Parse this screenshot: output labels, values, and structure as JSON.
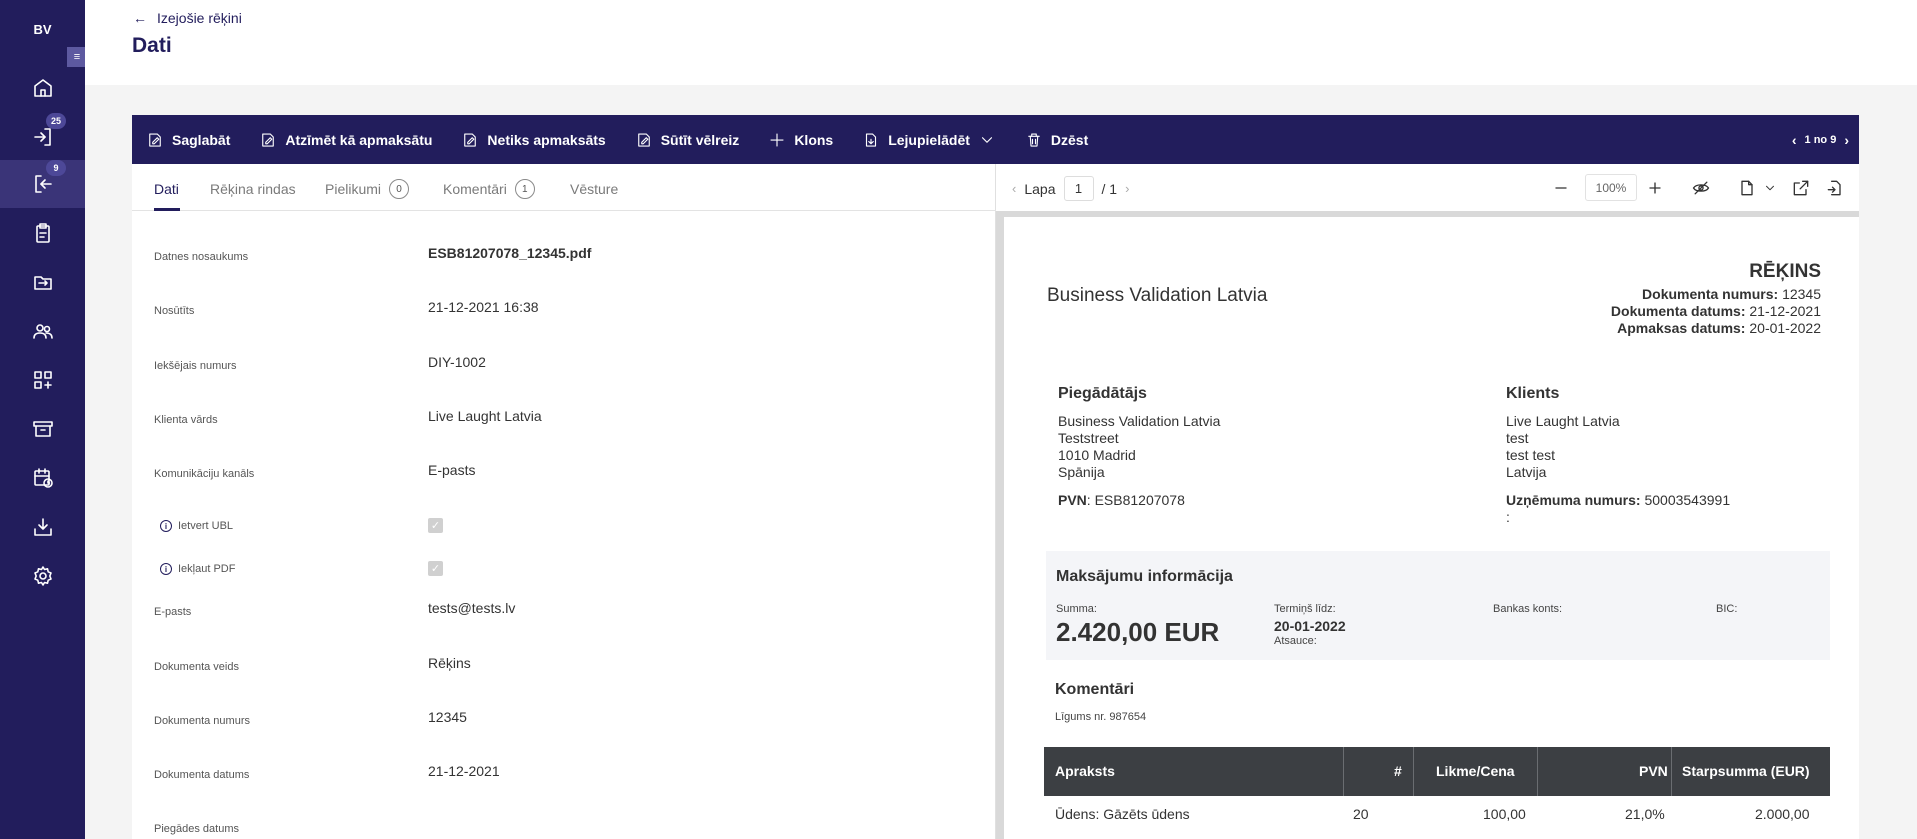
{
  "sidebar": {
    "brand": "BV",
    "badges": {
      "incoming": "25",
      "outgoing": "9"
    }
  },
  "header": {
    "back_label": "Izejošie rēķini",
    "title": "Dati"
  },
  "toolbar": {
    "save": "Saglabāt",
    "mark_paid": "Atzīmēt kā apmaksātu",
    "not_paid": "Netiks apmaksāts",
    "resend": "Sūtīt vēlreiz",
    "clone": "Klons",
    "download": "Lejupielādēt",
    "delete": "Dzēst",
    "pager": "1 no 9"
  },
  "tabs": {
    "data": "Dati",
    "invoice_rows": "Rēķina rindas",
    "attachments": "Pielikumi",
    "attachments_count": "0",
    "comments": "Komentāri",
    "comments_count": "1",
    "history": "Vēsture"
  },
  "fields": {
    "file_name_label": "Datnes nosaukums",
    "file_name": "ESB81207078_12345.pdf",
    "sent_label": "Nosūtīts",
    "sent": "21-12-2021 16:38",
    "internal_number_label": "Iekšējais numurs",
    "internal_number": "DIY-1002",
    "client_name_label": "Klienta vārds",
    "client_name": "Live Laught Latvia",
    "channel_label": "Komunikāciju kanāls",
    "channel": "E-pasts",
    "ubl_label": "Ietvert UBL",
    "pdf_label": "Iekļaut PDF",
    "email_label": "E-pasts",
    "email": "tests@tests.lv",
    "doc_type_label": "Dokumenta veids",
    "doc_type": "Rēķins",
    "doc_number_label": "Dokumenta numurs",
    "doc_number": "12345",
    "doc_date_label": "Dokumenta datums",
    "doc_date": "21-12-2021",
    "delivery_date_label": "Piegādes datums"
  },
  "viewer": {
    "page_label": "Lapa",
    "page_current": "1",
    "page_total": "/ 1",
    "zoom": "100%"
  },
  "document": {
    "company": "Business Validation Latvia",
    "title": "RĒĶINS",
    "doc_number_label": "Dokumenta numurs:",
    "doc_number": "12345",
    "doc_date_label": "Dokumenta datums:",
    "doc_date": "21-12-2021",
    "due_date_label": "Apmaksas datums:",
    "due_date": "20-01-2022",
    "supplier_title": "Piegādātājs",
    "supplier_lines": [
      "Business Validation Latvia",
      "Teststreet",
      "1010 Madrid",
      "Spānija"
    ],
    "supplier_vat_label": "PVN",
    "supplier_vat": ": ESB81207078",
    "client_title": "Klients",
    "client_lines": [
      "Live Laught Latvia",
      "test",
      "test test",
      "Latvija"
    ],
    "client_reg_label": "Uzņēmuma numurs:",
    "client_reg": "50003543991",
    "client_reg_colon": ":",
    "payment_title": "Maksājumu informācija",
    "sum_label": "Summa:",
    "sum": "2.420,00 EUR",
    "term_label": "Termiņš līdz:",
    "term": "20-01-2022",
    "reference_label": "Atsauce:",
    "bank_label": "Bankas konts:",
    "bic_label": "BIC:",
    "comments_title": "Komentāri",
    "comment": "Līgums nr. 987654",
    "table_headers": [
      "Apraksts",
      "#",
      "Likme/Cena",
      "PVN",
      "Starpsumma (EUR)"
    ],
    "table_rows": [
      [
        "Ūdens: Gāzēts ūdens",
        "20",
        "100,00",
        "21,0%",
        "2.000,00"
      ]
    ]
  }
}
